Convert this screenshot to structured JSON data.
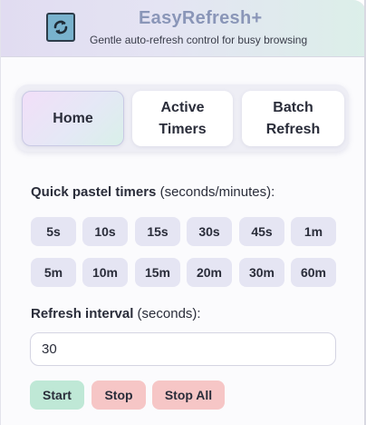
{
  "header": {
    "title": "EasyRefresh+",
    "subtitle": "Gentle auto-refresh control for busy browsing",
    "logo_icon": "refresh-arrows-icon"
  },
  "tabs": [
    {
      "label": "Home",
      "active": true
    },
    {
      "label": "Active Timers",
      "active": false
    },
    {
      "label": "Batch Refresh",
      "active": false
    }
  ],
  "quick_timers": {
    "label_bold": "Quick pastel timers",
    "label_rest": " (seconds/minutes):",
    "chips": [
      "5s",
      "10s",
      "15s",
      "30s",
      "45s",
      "1m",
      "5m",
      "10m",
      "15m",
      "20m",
      "30m",
      "60m"
    ]
  },
  "interval": {
    "label_bold": "Refresh interval",
    "label_rest": " (seconds):",
    "value": "30"
  },
  "actions": {
    "start_label": "Start",
    "stop_label": "Stop",
    "stop_all_label": "Stop All"
  },
  "colors": {
    "chip": "#e5e5f3",
    "start": "#bfe8d6",
    "stop": "#f6c6c6",
    "title": "#8a96b8"
  }
}
